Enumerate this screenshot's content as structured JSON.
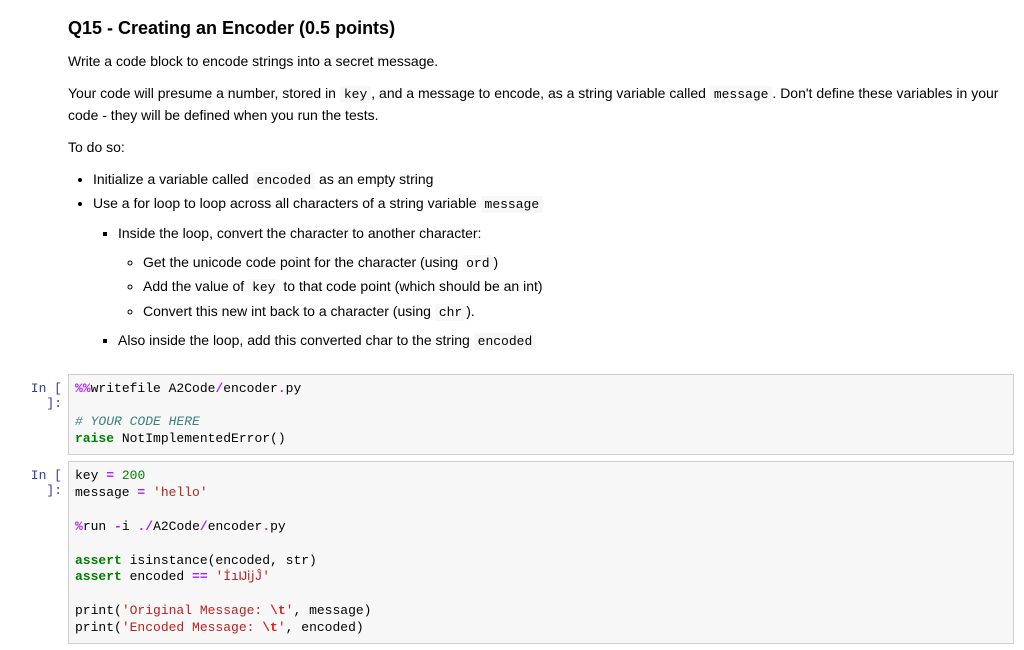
{
  "heading": "Q15 - Creating an Encoder (0.5 points)",
  "p1": "Write a code block to encode strings into a secret message.",
  "p2a": "Your code will presume a number, stored in ",
  "p2_key": "key",
  "p2b": ", and a message to encode, as a string variable called ",
  "p2_msg": "message",
  "p2c": ". Don't define these variables in your code - they will be defined when you run the tests.",
  "p3": "To do so:",
  "li1a": "Initialize a variable called ",
  "li1_code": "encoded",
  "li1b": " as an empty string",
  "li2a": "Use a for loop to loop across all characters of a string variable ",
  "li2_code": "message",
  "li2_1": "Inside the loop, convert the character to another character:",
  "li2_1_1a": "Get the unicode code point for the character (using ",
  "li2_1_1_code": "ord",
  "li2_1_1b": ")",
  "li2_1_2a": "Add the value of ",
  "li2_1_2_code": "key",
  "li2_1_2b": " to that code point (which should be an int)",
  "li2_1_3a": "Convert this new int back to a character (using ",
  "li2_1_3_code": "chr",
  "li2_1_3b": ").",
  "li2_2a": "Also inside the loop, add this converted char to the string ",
  "li2_2_code": "encoded",
  "prompt": "In [ ]:",
  "c1_l1_a": "%%",
  "c1_l1_b": "writefile A2Code",
  "c1_l1_c": "/",
  "c1_l1_d": "encoder",
  "c1_l1_e": ".",
  "c1_l1_f": "py",
  "c1_l3": "# YOUR CODE HERE",
  "c1_l4_a": "raise",
  "c1_l4_b": " NotImplementedError()",
  "c2_l1_a": "key ",
  "c2_l1_b": "=",
  "c2_l1_c": " ",
  "c2_l1_d": "200",
  "c2_l2_a": "message ",
  "c2_l2_b": "=",
  "c2_l2_c": " ",
  "c2_l2_d": "'hello'",
  "c2_l4_a": "%",
  "c2_l4_b": "run ",
  "c2_l4_c": "-",
  "c2_l4_d": "i ",
  "c2_l4_e": ".",
  "c2_l4_f": "/",
  "c2_l4_g": "A2Code",
  "c2_l4_h": "/",
  "c2_l4_i": "encoder",
  "c2_l4_j": ".",
  "c2_l4_k": "py",
  "c2_l6_a": "assert",
  "c2_l6_b": " isinstance(encoded, str)",
  "c2_l7_a": "assert",
  "c2_l7_b": " encoded ",
  "c2_l7_c": "==",
  "c2_l7_d": " ",
  "c2_l7_e": "'İıĲĳĴ'",
  "c2_l9_a": "print(",
  "c2_l9_b": "'Original Message: ",
  "c2_l9_c": "\\t",
  "c2_l9_d": "'",
  "c2_l9_e": ", message)",
  "c2_l10_a": "print(",
  "c2_l10_b": "'Encoded Message: ",
  "c2_l10_c": "\\t",
  "c2_l10_d": "'",
  "c2_l10_e": ", encoded)"
}
